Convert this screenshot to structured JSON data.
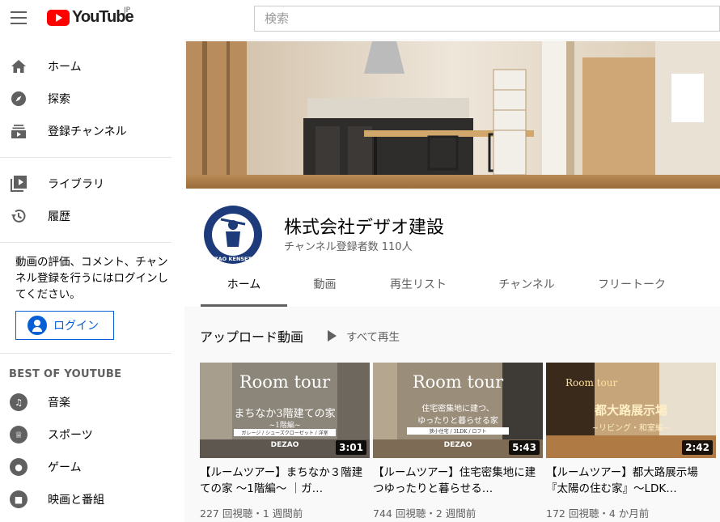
{
  "header": {
    "logo_text": "YouTube",
    "region": "JP",
    "search_placeholder": "検索"
  },
  "sidebar": {
    "primary": [
      {
        "label": "ホーム",
        "icon": "home-icon"
      },
      {
        "label": "探索",
        "icon": "compass-icon"
      },
      {
        "label": "登録チャンネル",
        "icon": "subscriptions-icon"
      }
    ],
    "secondary": [
      {
        "label": "ライブラリ",
        "icon": "library-icon"
      },
      {
        "label": "履歴",
        "icon": "history-icon"
      }
    ],
    "signin_prompt": "動画の評価、コメント、チャンネル登録を行うにはログインしてください。",
    "login_label": "ログイン",
    "best_title": "BEST OF YOUTUBE",
    "best": [
      {
        "label": "音楽",
        "icon": "music-icon"
      },
      {
        "label": "スポーツ",
        "icon": "trophy-icon"
      },
      {
        "label": "ゲーム",
        "icon": "gaming-icon"
      },
      {
        "label": "映画と番組",
        "icon": "film-icon"
      }
    ]
  },
  "channel": {
    "name": "株式会社デザオ建設",
    "subscribers": "チャンネル登録者数 110人",
    "avatar_text": "DEZAO KENSETSU",
    "tabs": [
      "ホーム",
      "動画",
      "再生リスト",
      "チャンネル",
      "フリートーク"
    ],
    "active_tab": "ホーム"
  },
  "uploads": {
    "title": "アップロード動画",
    "play_all": "すべて再生",
    "videos": [
      {
        "title": "【ルームツアー】まちなか３階建ての家 〜1階編〜 ｜ガ…",
        "meta": "227 回視聴・1 週間前",
        "duration": "3:01",
        "thumb_line1": "Room tour",
        "thumb_line2": "まちなか3階建ての家",
        "thumb_line3": "~1階編~",
        "thumb_line4": "ガレージ / シューズクローゼット / 洋室",
        "thumb_brand": "DEZAO"
      },
      {
        "title": "【ルームツアー】住宅密集地に建つゆったりと暮らせる…",
        "meta": "744 回視聴・2 週間前",
        "duration": "5:43",
        "thumb_line1": "Room tour",
        "thumb_line2": "住宅密集地に建つ、",
        "thumb_line3": "ゆったりと暮らせる家",
        "thumb_line4": "狭小住宅 / 3LDK / ロフト",
        "thumb_brand": "DEZAO"
      },
      {
        "title": "【ルームツアー】都大路展示場『太陽の住む家』〜LDK…",
        "meta": "172 回視聴・4 か月前",
        "duration": "2:42",
        "thumb_line1": "Room tour",
        "thumb_line2": "都大路展示場",
        "thumb_line3": "~リビング・和室編~"
      }
    ]
  },
  "colors": {
    "brand_red": "#ff0000",
    "link_blue": "#065fd4",
    "text_secondary": "#606060"
  }
}
